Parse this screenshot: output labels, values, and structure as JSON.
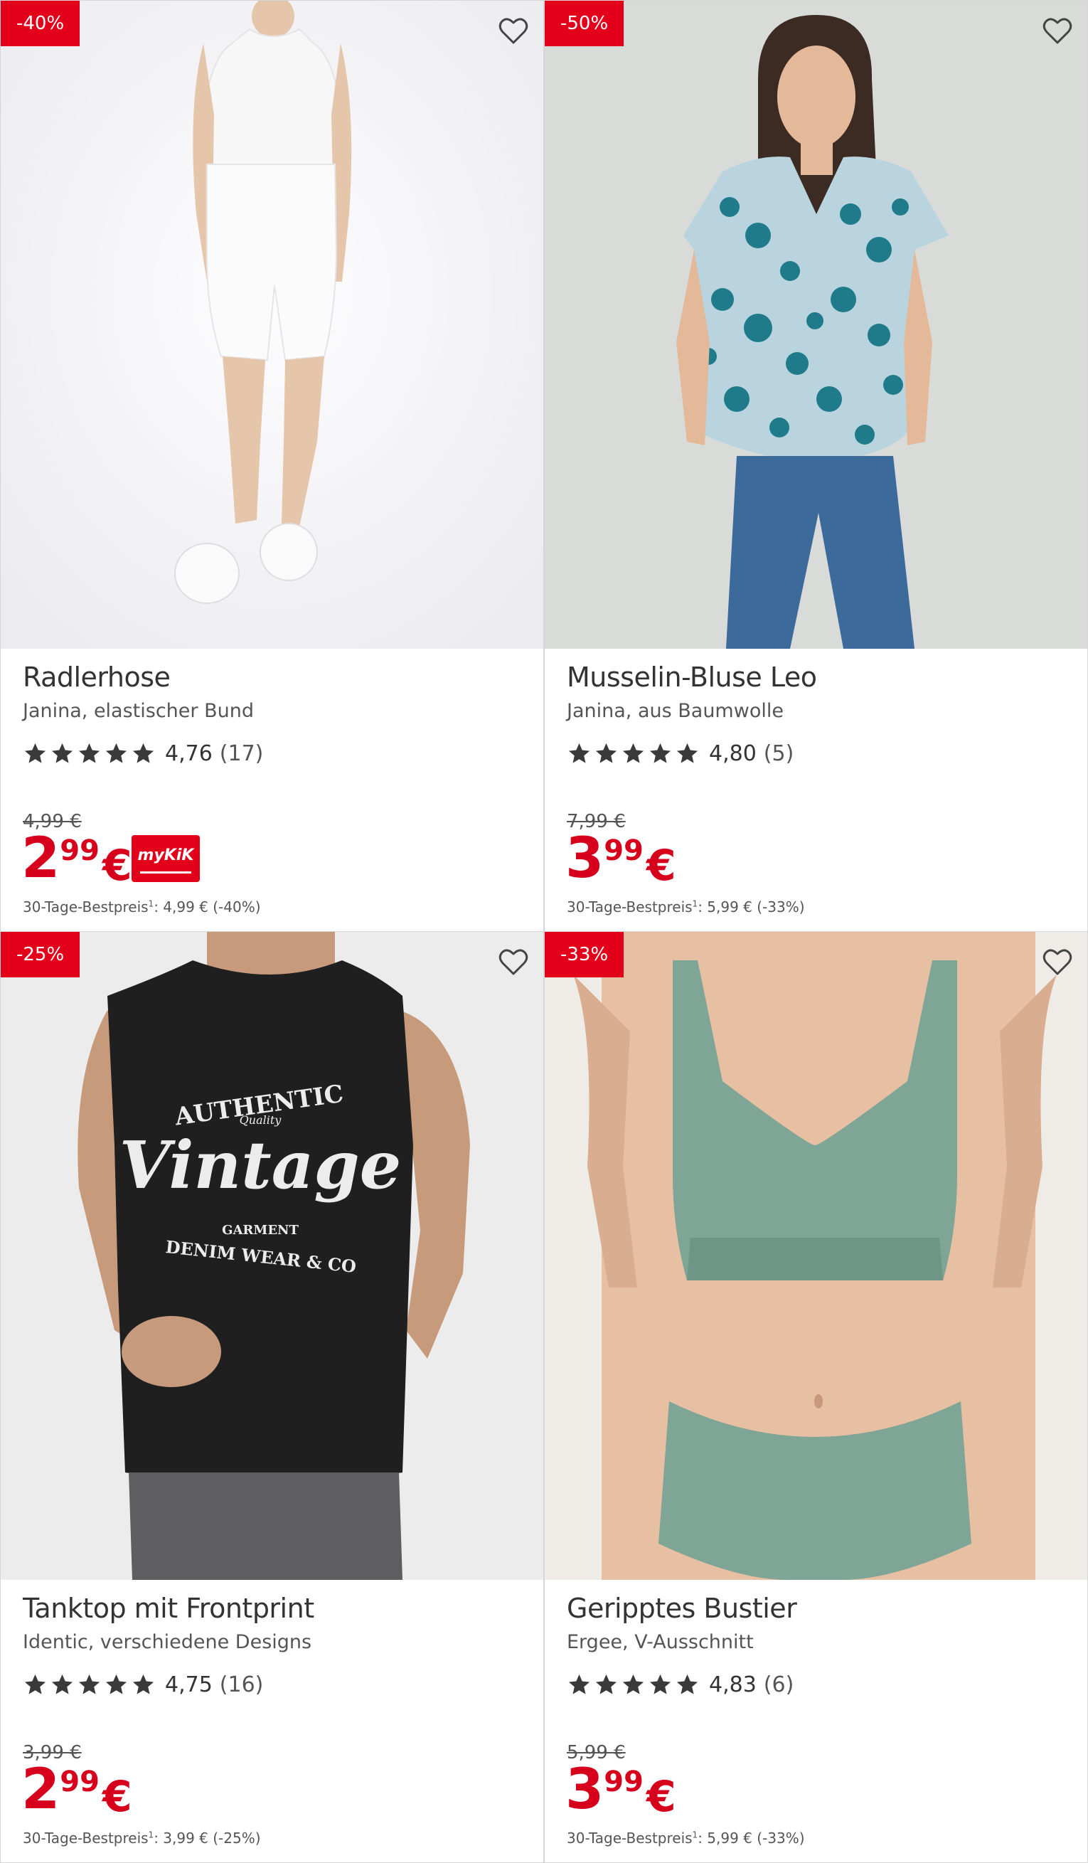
{
  "products": [
    {
      "badge": "-40%",
      "title": "Radlerhose",
      "subtitle": "Janina, elastischer Bund",
      "rating": "4,76",
      "rating_count": "(17)",
      "old_price": "4,99 €",
      "price_euros": "2",
      "price_cents": "99",
      "currency": "€",
      "mykik": "myKiK",
      "best_label": "30-Tage-Bestpreis",
      "best_sup": "1",
      "best_value": ": 4,99 € (-40%)"
    },
    {
      "badge": "-50%",
      "title": "Musselin-Bluse Leo",
      "subtitle": "Janina, aus Baumwolle",
      "rating": "4,80",
      "rating_count": "(5)",
      "old_price": "7,99 €",
      "price_euros": "3",
      "price_cents": "99",
      "currency": "€",
      "best_label": "30-Tage-Bestpreis",
      "best_sup": "1",
      "best_value": ": 5,99 € (-33%)"
    },
    {
      "badge": "-25%",
      "title": "Tanktop mit Frontprint",
      "subtitle": "Identic, verschiedene Designs",
      "rating": "4,75",
      "rating_count": "(16)",
      "old_price": "3,99 €",
      "price_euros": "2",
      "price_cents": "99",
      "currency": "€",
      "best_label": "30-Tage-Bestpreis",
      "best_sup": "1",
      "best_value": ": 3,99 € (-25%)",
      "print_text": {
        "line1": "AUTHENTIC",
        "line2": "Quality",
        "line3": "Vintage",
        "line4": "GARMENT",
        "line5": "DENIM WEAR & CO"
      }
    },
    {
      "badge": "-33%",
      "title": "Geripptes Bustier",
      "subtitle": "Ergee, V-Ausschnitt",
      "rating": "4,83",
      "rating_count": "(6)",
      "old_price": "5,99 €",
      "price_euros": "3",
      "price_cents": "99",
      "currency": "€",
      "best_label": "30-Tage-Bestpreis",
      "best_sup": "1",
      "best_value": ": 5,99 € (-33%)"
    }
  ],
  "icons": {
    "favorite": "heart-outline-icon",
    "star": "star-filled-icon"
  },
  "colors": {
    "accent": "#e2001a",
    "price": "#d6001c",
    "text": "#333333"
  }
}
